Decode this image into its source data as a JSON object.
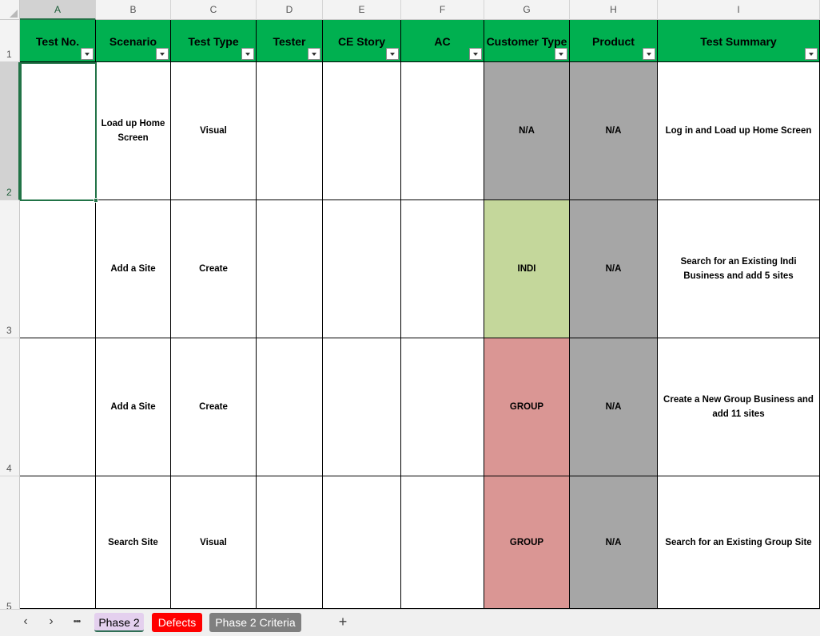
{
  "columns": [
    "A",
    "B",
    "C",
    "D",
    "E",
    "F",
    "G",
    "H",
    "I"
  ],
  "rows": [
    "1",
    "2",
    "3",
    "4",
    "5"
  ],
  "headers": [
    "Test No.",
    "Scenario",
    "Test Type",
    "Tester",
    "CE Story",
    "AC",
    "Customer Type",
    "Product",
    "Test Summary"
  ],
  "data": [
    [
      "",
      "Load up Home Screen",
      "Visual",
      "",
      "",
      "",
      "N/A",
      "N/A",
      "Log in and Load up Home Screen"
    ],
    [
      "",
      "Add a Site",
      "Create",
      "",
      "",
      "",
      "INDI",
      "N/A",
      "Search for an Existing Indi Business and add 5 sites"
    ],
    [
      "",
      "Add a Site",
      "Create",
      "",
      "",
      "",
      "GROUP",
      "N/A",
      "Create a New Group Business and add 11 sites"
    ],
    [
      "",
      "Search Site",
      "Visual",
      "",
      "",
      "",
      "GROUP",
      "N/A",
      "Search for an Existing Group Site"
    ]
  ],
  "sheets": {
    "tabs": [
      "Phase 2",
      "Defects",
      "Phase 2 Criteria"
    ],
    "active": "Phase 2"
  },
  "nav": {
    "prev": "‹",
    "next": "›",
    "more": "•••",
    "add": "+"
  },
  "colors": {
    "header_green": "#00b050",
    "na_gray": "#a6a6a6",
    "indi_green": "#c4d79b",
    "group_red": "#da9694",
    "tab_red": "#ff0000",
    "tab_gray": "#7f7f7f"
  }
}
